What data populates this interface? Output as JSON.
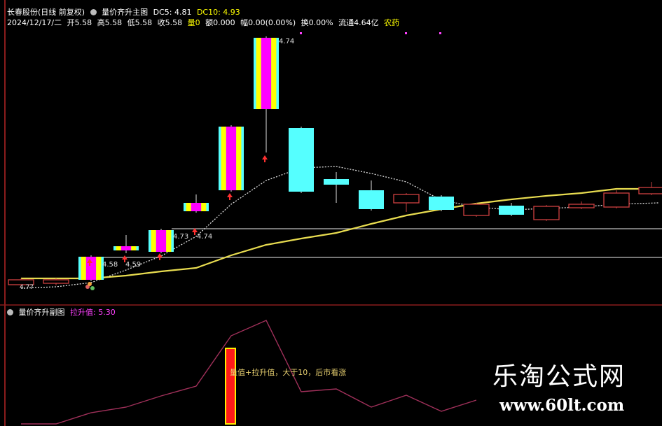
{
  "main_panel": {
    "stock_name": "长春股份(日线 前复权)",
    "indicator_name": "量价齐升主图",
    "dc5_label": "DC5: 4.81",
    "dc10_label": "DC10: 4.93",
    "quote_line": {
      "date": "2024/12/17/二",
      "open": "开5.58",
      "high": "高5.58",
      "low": "低5.58",
      "close": "收5.58",
      "volume": "量0",
      "amount": "额0.000",
      "change": "幅0.00(0.00%)",
      "turnover": "换0.00%",
      "float_cap": "流通4.64亿",
      "sector": "农药"
    },
    "price_labels": [
      "4.58",
      "4.59",
      "4.73",
      "4.74",
      "4.74",
      "4.77"
    ],
    "colors": {
      "yang_fill": "#ff00ff",
      "yellow": "#ffff00",
      "cyan": "#55ffff",
      "red": "#ff3030",
      "ma_yellow": "#e8dc50",
      "ma_dotted": "#e0e0e0"
    }
  },
  "sub_panel": {
    "indicator_name": "量价齐升副图",
    "value_label": "拉升值: 5.30",
    "annotation": "量值+拉升值，大于10，后市看涨",
    "line_color": "#a0305a"
  },
  "watermark": {
    "title": "乐淘公式网",
    "url": "www.60lt.com"
  }
}
